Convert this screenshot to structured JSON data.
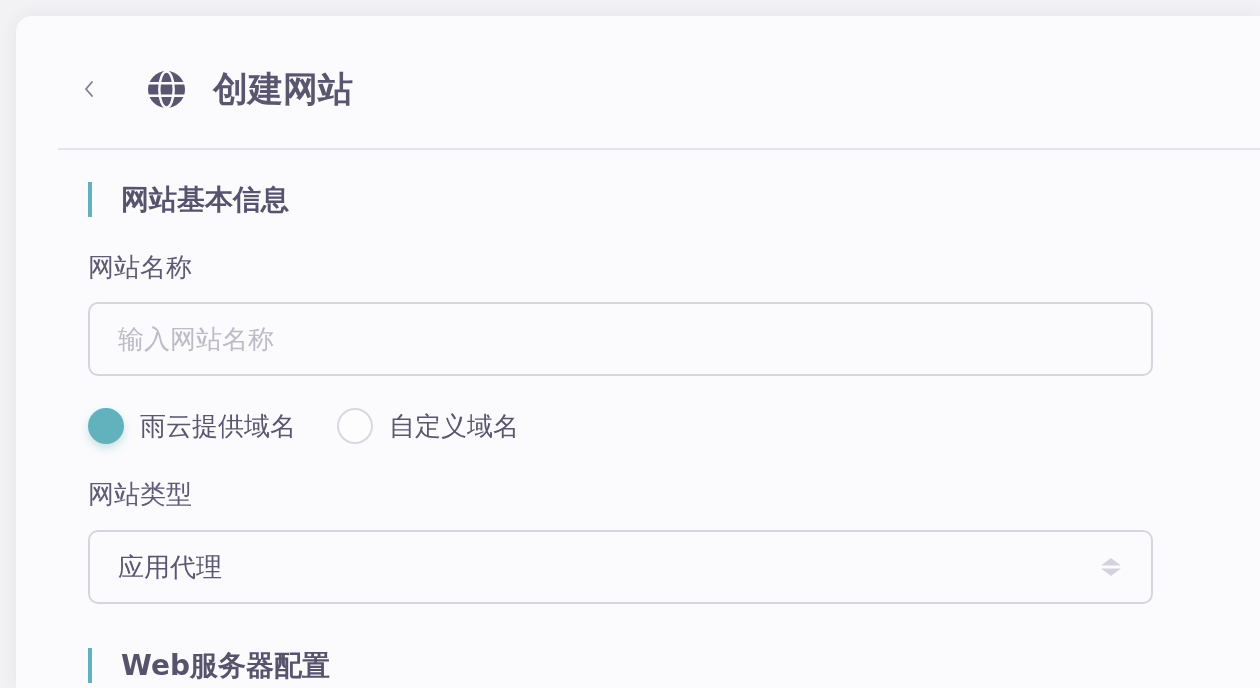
{
  "header": {
    "title": "创建网站"
  },
  "sections": [
    {
      "title": "网站基本信息",
      "fields": [
        {
          "kind": "text",
          "label": "网站名称",
          "placeholder": "输入网站名称"
        },
        {
          "kind": "radio",
          "options": [
            {
              "label": "雨云提供域名",
              "selected": true
            },
            {
              "label": "自定义域名",
              "selected": false
            }
          ]
        },
        {
          "kind": "select",
          "label": "网站类型",
          "value": "应用代理"
        }
      ]
    },
    {
      "title": "Web服务器配置"
    }
  ]
}
